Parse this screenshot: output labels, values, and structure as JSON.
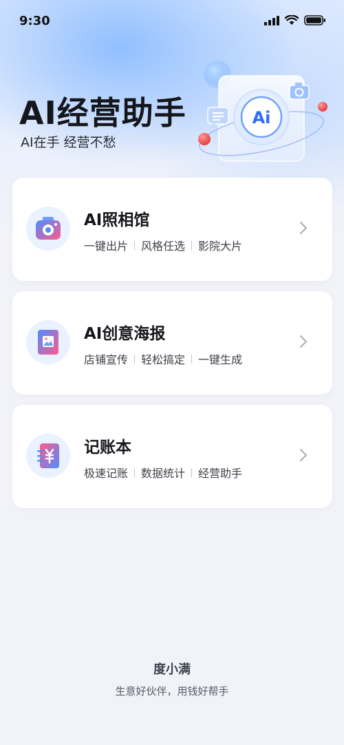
{
  "status_bar": {
    "time": "9:30",
    "icons": [
      "signal-icon",
      "wifi-icon",
      "battery-icon"
    ]
  },
  "header": {
    "title": "AI经营助手",
    "subtitle": "AI在手 经营不愁",
    "badge_text": "Ai"
  },
  "colors": {
    "accent": "#2F6BFF",
    "background": "#F2F3F8",
    "card": "#FFFFFF",
    "red_dot": "#F24B4B"
  },
  "cards": [
    {
      "title": "AI照相馆",
      "icon": "camera-icon",
      "tags": [
        "一键出片",
        "风格任选",
        "影院大片"
      ]
    },
    {
      "title": "AI创意海报",
      "icon": "poster-icon",
      "tags": [
        "店铺宣传",
        "轻松搞定",
        "一键生成"
      ]
    },
    {
      "title": "记账本",
      "icon": "ledger-icon",
      "tags": [
        "极速记账",
        "数据统计",
        "经营助手"
      ]
    }
  ],
  "footer": {
    "brand": "度小满",
    "slogan": "生意好伙伴，用钱好帮手"
  }
}
